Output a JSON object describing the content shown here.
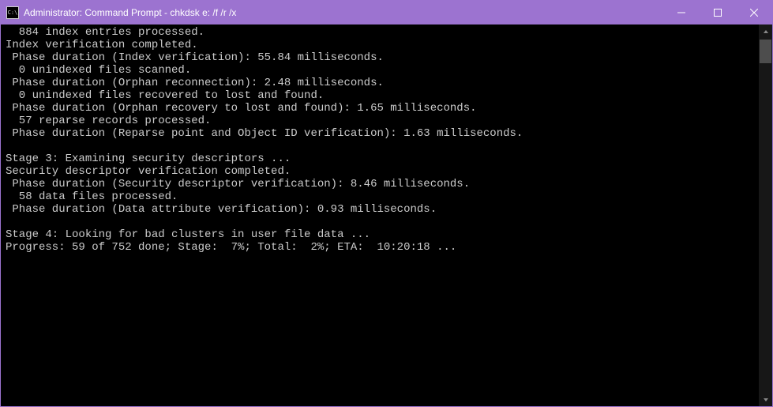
{
  "window": {
    "title": "Administrator: Command Prompt - chkdsk  e: /f /r /x",
    "icon_text": "C:\\"
  },
  "output": {
    "lines": [
      "  884 index entries processed.",
      "Index verification completed.",
      " Phase duration (Index verification): 55.84 milliseconds.",
      "  0 unindexed files scanned.",
      " Phase duration (Orphan reconnection): 2.48 milliseconds.",
      "  0 unindexed files recovered to lost and found.",
      " Phase duration (Orphan recovery to lost and found): 1.65 milliseconds.",
      "  57 reparse records processed.",
      " Phase duration (Reparse point and Object ID verification): 1.63 milliseconds.",
      "",
      "Stage 3: Examining security descriptors ...",
      "Security descriptor verification completed.",
      " Phase duration (Security descriptor verification): 8.46 milliseconds.",
      "  58 data files processed.",
      " Phase duration (Data attribute verification): 0.93 milliseconds.",
      "",
      "Stage 4: Looking for bad clusters in user file data ...",
      "Progress: 59 of 752 done; Stage:  7%; Total:  2%; ETA:  10:20:18 ..."
    ]
  }
}
